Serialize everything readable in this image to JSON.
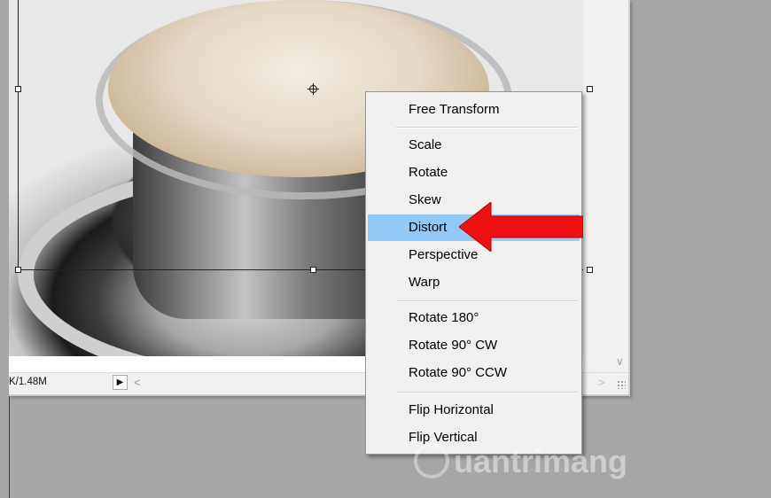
{
  "statusbar": {
    "doc_size": "K/1.48M",
    "arrow_glyph": "▶",
    "scroll_left": "<",
    "scroll_right": ">",
    "scroll_down": "∨"
  },
  "context_menu": {
    "highlight_color": "#91c9f7",
    "highlighted_item": "Distort",
    "items": [
      {
        "label": "Free Transform"
      },
      {
        "label": "Scale"
      },
      {
        "label": "Rotate"
      },
      {
        "label": "Skew"
      },
      {
        "label": "Distort"
      },
      {
        "label": "Perspective"
      },
      {
        "label": "Warp"
      },
      {
        "label": "Rotate 180°"
      },
      {
        "label": "Rotate 90° CW"
      },
      {
        "label": "Rotate 90° CCW"
      },
      {
        "label": "Flip Horizontal"
      },
      {
        "label": "Flip Vertical"
      }
    ]
  },
  "annotation": {
    "arrow_color": "#ee1111",
    "arrow_icon": "red-arrow-icon"
  },
  "watermark": {
    "text": "uantrimang"
  }
}
